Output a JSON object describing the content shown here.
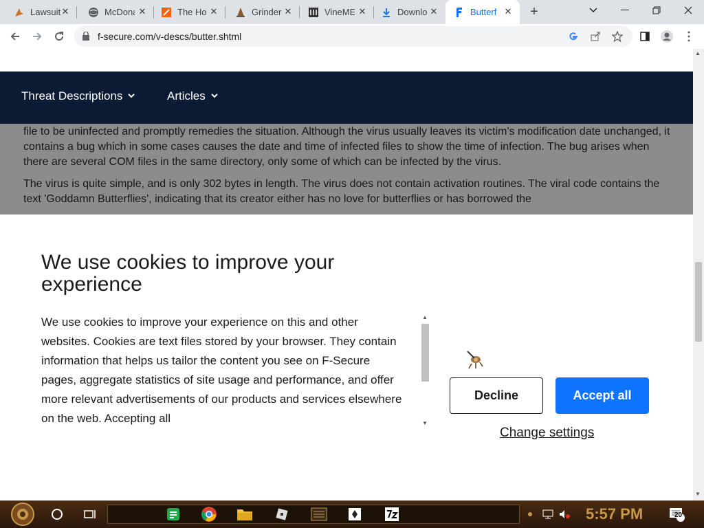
{
  "browser": {
    "tabs": [
      {
        "title": "Lawsuit",
        "icon": "bird-icon",
        "active": false
      },
      {
        "title": "McDona",
        "icon": "globe-icon",
        "active": false
      },
      {
        "title": "The Ho",
        "icon": "home-depot-icon",
        "active": false
      },
      {
        "title": "Grinder",
        "icon": "cone-icon",
        "active": false
      },
      {
        "title": "VineME",
        "icon": "vine-icon",
        "active": false
      },
      {
        "title": "Downlo",
        "icon": "download-icon",
        "active": false
      },
      {
        "title": "Butterf",
        "icon": "f-secure-icon",
        "active": true
      }
    ],
    "url": "f-secure.com/v-descs/butter.shtml"
  },
  "site_nav": {
    "items": [
      "Threat Descriptions",
      "Articles"
    ]
  },
  "article": {
    "paragraph1": "file to be uninfected and promptly remedies the situation. Although the virus usually leaves its victim's modification date unchanged, it contains a bug which in some cases causes the date and time of infected files to show the time of infection. The bug arises when there are several COM files in the same directory, only some of which can be infected by the virus.",
    "paragraph2": "The virus is quite simple, and is only 302 bytes in length. The virus does not contain activation routines. The viral code contains the text 'Goddamn Butterflies', indicating that its creator either has no love for butterflies or has borrowed the"
  },
  "cookie_banner": {
    "title": "We use cookies to improve your experience",
    "body": "We use cookies to improve your experience on this and other websites. Cookies are text files stored by your browser. They contain information that helps us tailor the content you see on F-Secure pages, aggregate statistics of site usage and performance, and offer more relevant advertisements of our products and services elsewhere on the web. Accepting all",
    "decline_label": "Decline",
    "accept_label": "Accept all",
    "settings_label": "Change settings"
  },
  "taskbar": {
    "time": "5:57 PM",
    "notification_count": "20"
  },
  "colors": {
    "nav_bg": "#0b1b34",
    "accept_bg": "#0e74ff"
  }
}
